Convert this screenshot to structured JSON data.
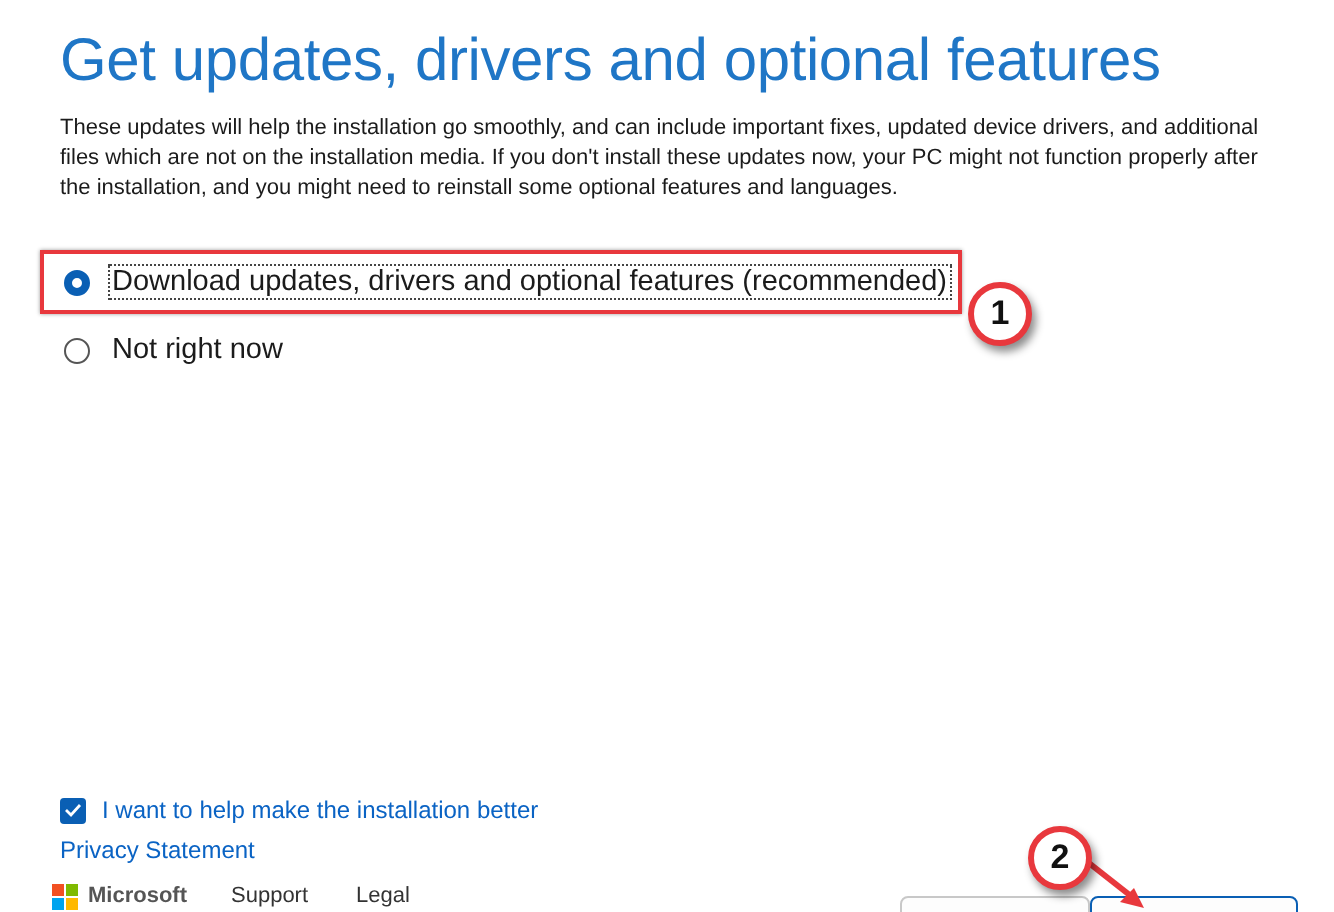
{
  "title": "Get updates, drivers and optional features",
  "description": "These updates will help the installation go smoothly, and can include important fixes, updated device drivers, and additional files which are not on the installation media. If you don't install these updates now, your PC might not function properly after the installation, and you might need to reinstall some optional features and languages.",
  "options": [
    {
      "label": "Download updates, drivers and optional features (recommended)",
      "selected": true,
      "highlighted": true
    },
    {
      "label": "Not right now",
      "selected": false,
      "highlighted": false
    }
  ],
  "consent": {
    "label": "I want to help make the installation better",
    "checked": true
  },
  "privacy_link": "Privacy Statement",
  "footer_links": [
    "Microsoft",
    "Support",
    "Legal"
  ],
  "footer_buttons": [
    {
      "primary": false
    },
    {
      "primary": true
    }
  ],
  "callouts": [
    {
      "number": "1"
    },
    {
      "number": "2"
    }
  ]
}
